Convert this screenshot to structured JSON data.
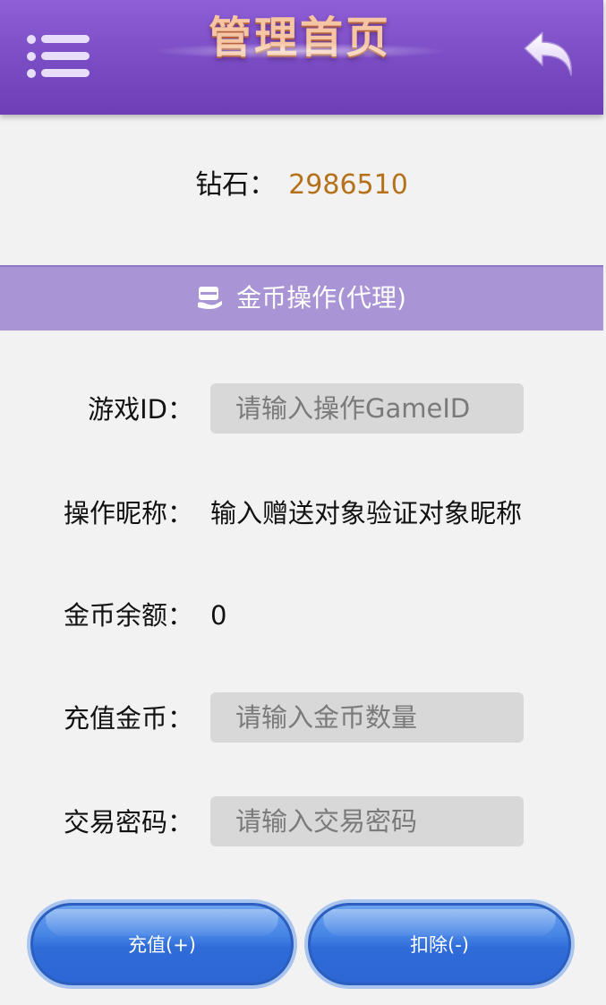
{
  "header": {
    "title": "管理首页",
    "menu_icon": "menu-icon",
    "back_icon": "back-arrow-icon"
  },
  "balance": {
    "label": "钻石：",
    "value": "2986510",
    "value_color": "#b5711a"
  },
  "section": {
    "icon": "wallet-icon",
    "title": "金币操作(代理)"
  },
  "form": {
    "game_id": {
      "label": "游戏ID：",
      "placeholder": "请输入操作GameID"
    },
    "nickname": {
      "label": "操作昵称：",
      "value": "输入赠送对象验证对象昵称"
    },
    "balance": {
      "label": "金币余额：",
      "value": "0"
    },
    "recharge": {
      "label": "充值金币：",
      "placeholder": "请输入金币数量"
    },
    "password": {
      "label": "交易密码：",
      "placeholder": "请输入交易密码"
    }
  },
  "actions": {
    "recharge_label": "充值(+)",
    "deduct_label": "扣除(-)"
  },
  "colors": {
    "header": "#7a4cc4",
    "section": "#a994d6",
    "button": "#2f6cd9",
    "background": "#f2f2f2"
  }
}
